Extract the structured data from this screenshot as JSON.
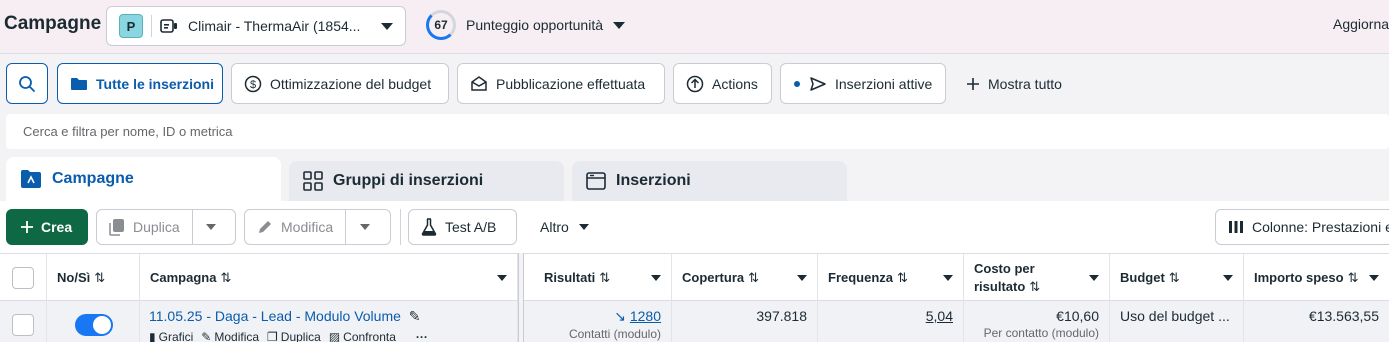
{
  "app": {
    "title": "Campagne"
  },
  "account": {
    "initial": "P",
    "name": "Climair - ThermaAir (1854..."
  },
  "score": {
    "value": "67",
    "label": "Punteggio opportunità"
  },
  "header": {
    "update_label": "Aggiorna"
  },
  "filters": {
    "all_ads": "Tutte le inserzioni",
    "budget_opt": "Ottimizzazione del budget",
    "published": "Pubblicazione effettuata",
    "actions": "Actions",
    "active_ads": "Inserzioni attive",
    "show_all": "Mostra tutto"
  },
  "search": {
    "placeholder": "Cerca e filtra per nome, ID o metrica"
  },
  "tabs": {
    "campaigns": "Campagne",
    "adsets": "Gruppi di inserzioni",
    "ads": "Inserzioni"
  },
  "toolbar": {
    "create": "Crea",
    "duplicate": "Duplica",
    "edit": "Modifica",
    "ab_test": "Test A/B",
    "more": "Altro",
    "columns": "Colonne: Prestazioni e"
  },
  "table": {
    "headers": {
      "onoff": "No/Sì",
      "campaign": "Campagna",
      "results": "Risultati",
      "reach": "Copertura",
      "frequency": "Frequenza",
      "cost_per_result": "Costo per risultato",
      "budget": "Budget",
      "amount_spent": "Importo speso"
    },
    "rows": [
      {
        "on": true,
        "name": "11.05.25 - Daga - Lead - Modulo Volume",
        "actions": {
          "charts": "Grafici",
          "edit": "Modifica",
          "duplicate": "Duplica",
          "compare": "Confronta"
        },
        "results": "1280",
        "results_sub": "Contatti (modulo)",
        "reach": "397.818",
        "frequency": "5,04",
        "cost": "€10,60",
        "cost_sub": "Per contatto (modulo)",
        "budget": "Uso del budget ...",
        "spent": "€13.563,55"
      }
    ]
  },
  "colors": {
    "accent": "#0a5cad",
    "create": "#0e6844",
    "toggle": "#1877f2"
  }
}
